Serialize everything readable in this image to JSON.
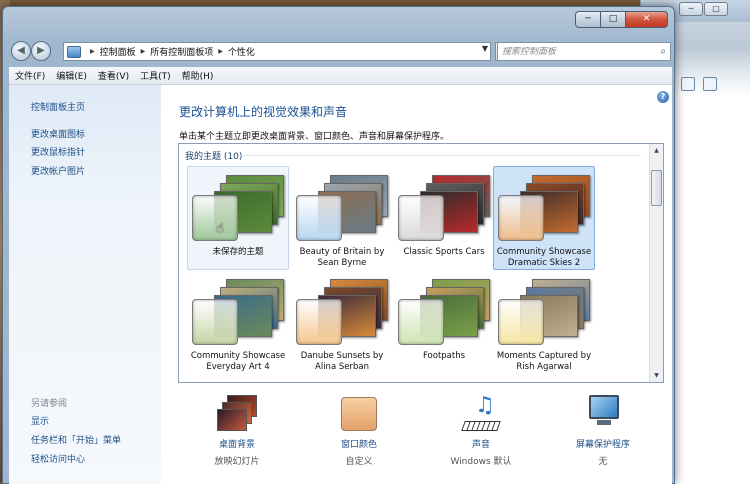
{
  "window": {
    "controls": {
      "minimize": "─",
      "maximize": "□",
      "close": "✕"
    }
  },
  "nav": {
    "back": "◀",
    "forward": "▶",
    "breadcrumb": [
      "控制面板",
      "所有控制面板项",
      "个性化"
    ],
    "search_placeholder": "搜索控制面板"
  },
  "menu": [
    "文件(F)",
    "编辑(E)",
    "查看(V)",
    "工具(T)",
    "帮助(H)"
  ],
  "sidebar": {
    "home": "控制面板主页",
    "links": [
      "更改桌面图标",
      "更改鼠标指针",
      "更改帐户图片"
    ],
    "see_also_heading": "另请参阅",
    "see_also": [
      "显示",
      "任务栏和「开始」菜单",
      "轻松访问中心"
    ]
  },
  "main": {
    "title": "更改计算机上的视觉效果和声音",
    "description": "单击某个主题立即更改桌面背景、窗口颜色、声音和屏幕保护程序。",
    "group_label": "我的主题 (10)",
    "themes": [
      {
        "name": "未保存的主题",
        "state": "hover",
        "swatch": "#9fc79a",
        "photo_colors": [
          "#5b8a3c",
          "#7fa85a",
          "#3d6a2c"
        ]
      },
      {
        "name": "Beauty of Britain by Sean Byrne",
        "state": "normal",
        "swatch": "#b9d6f0",
        "photo_colors": [
          "#6a7a88",
          "#9aa8b3",
          "#8c6e4e"
        ]
      },
      {
        "name": "Classic Sports Cars",
        "state": "normal",
        "swatch": "#d9d9d9",
        "photo_colors": [
          "#b82a2a",
          "#606060",
          "#2b2b2b"
        ]
      },
      {
        "name": "Community Showcase Dramatic Skies 2",
        "state": "selected",
        "swatch": "#efbc8a",
        "photo_colors": [
          "#c46b2e",
          "#8f4a24",
          "#3d2a2a"
        ]
      },
      {
        "name": "Community Showcase Everyday Art 4",
        "state": "normal",
        "swatch": "#c6d4a6",
        "photo_colors": [
          "#6a8a5a",
          "#bfae7a",
          "#3a6a8a"
        ]
      },
      {
        "name": "Danube Sunsets by Alina Serban",
        "state": "normal",
        "swatch": "#f4c68e",
        "photo_colors": [
          "#d98a3a",
          "#7a4a2a",
          "#3a2a3a"
        ]
      },
      {
        "name": "Footpaths",
        "state": "normal",
        "swatch": "#cfe3b4",
        "photo_colors": [
          "#7aa04a",
          "#c7a060",
          "#4a6a3a"
        ]
      },
      {
        "name": "Moments Captured by Rish Agarwal",
        "state": "normal",
        "swatch": "#f6e6a4",
        "photo_colors": [
          "#c0b090",
          "#5a7aa0",
          "#8a7a5a"
        ]
      }
    ]
  },
  "quick_links": [
    {
      "label": "桌面背景",
      "sub": "放映幻灯片"
    },
    {
      "label": "窗口颜色",
      "sub": "自定义"
    },
    {
      "label": "声音",
      "sub": "Windows 默认"
    },
    {
      "label": "屏幕保护程序",
      "sub": "无"
    }
  ],
  "colors": {
    "link": "#1c4e86",
    "title": "#1a4f95",
    "selected": "#cfe3f8"
  }
}
